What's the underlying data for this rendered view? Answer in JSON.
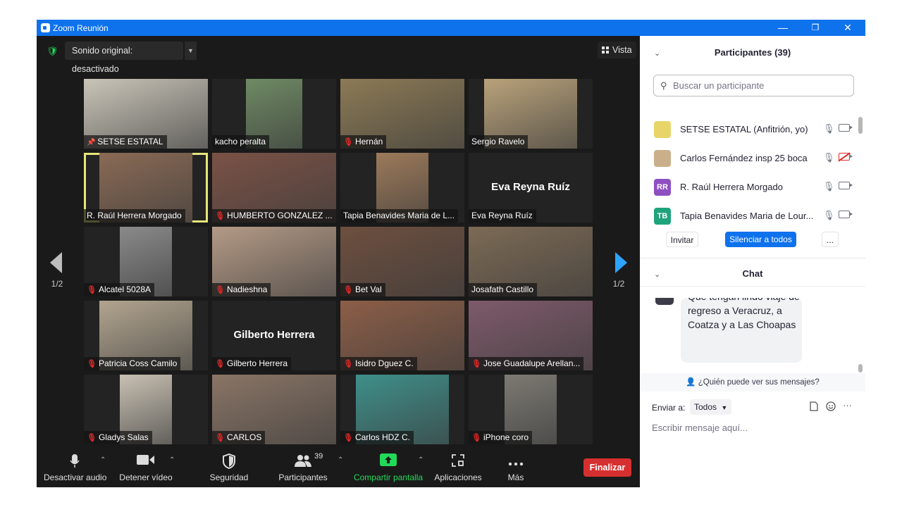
{
  "window": {
    "title": "Zoom Reunión",
    "minimize": "—",
    "restore": "❐",
    "close": "✕"
  },
  "top": {
    "sound_label": "Sonido original: desactivado",
    "view_label": "Vista"
  },
  "page_indicator": "1/2",
  "tiles": [
    {
      "name": "SETSE ESTATAL",
      "muted": false,
      "pinned": true,
      "big": "",
      "bg": "#c9c4b8",
      "vw": 176
    },
    {
      "name": "kacho peralta",
      "muted": false,
      "pinned": false,
      "big": "",
      "bg": "#6f8a64",
      "vw": 80
    },
    {
      "name": "Hernán",
      "muted": true,
      "pinned": false,
      "big": "",
      "bg": "#8c7a55",
      "vw": 176
    },
    {
      "name": "Sergio Ravelo",
      "muted": false,
      "pinned": false,
      "big": "",
      "bg": "#b9a27a",
      "vw": 132
    },
    {
      "name": "R. Raúl Herrera Morgado",
      "muted": false,
      "pinned": false,
      "big": "",
      "bg": "#8a6a55",
      "vw": 132,
      "active": true
    },
    {
      "name": "HUMBERTO GONZALEZ ...",
      "muted": true,
      "pinned": false,
      "big": "",
      "bg": "#7a5246",
      "vw": 176
    },
    {
      "name": "Tapia Benavides Maria de L...",
      "muted": false,
      "pinned": false,
      "big": "",
      "bg": "#9c7a5a",
      "vw": 74
    },
    {
      "name": "Eva Reyna Ruíz",
      "muted": false,
      "pinned": false,
      "big": "Eva Reyna Ruíz",
      "bg": "#232323",
      "vw": 0
    },
    {
      "name": "Alcatel 5028A",
      "muted": true,
      "pinned": false,
      "big": "",
      "bg": "#8a8a8a",
      "vw": 74
    },
    {
      "name": "Nadieshna",
      "muted": true,
      "pinned": false,
      "big": "",
      "bg": "#b49a86",
      "vw": 176
    },
    {
      "name": "Bet Val",
      "muted": true,
      "pinned": false,
      "big": "",
      "bg": "#6d4f3f",
      "vw": 176
    },
    {
      "name": "Josafath Castillo",
      "muted": false,
      "pinned": false,
      "big": "",
      "bg": "#7c6a55",
      "vw": 176
    },
    {
      "name": "Patricia Coss Camilo",
      "muted": true,
      "pinned": false,
      "big": "",
      "bg": "#b2a58f",
      "vw": 132
    },
    {
      "name": "Gilberto Herrera",
      "muted": true,
      "pinned": false,
      "big": "Gilberto Herrera",
      "bg": "#232323",
      "vw": 0
    },
    {
      "name": "Isidro Dguez C.",
      "muted": true,
      "pinned": false,
      "big": "",
      "bg": "#8c5e48",
      "vw": 176
    },
    {
      "name": "Jose Guadalupe Arellan...",
      "muted": true,
      "pinned": false,
      "big": "",
      "bg": "#7e5a6a",
      "vw": 176
    },
    {
      "name": "Gladys Salas",
      "muted": true,
      "pinned": false,
      "big": "",
      "bg": "#c8c0b2",
      "vw": 74
    },
    {
      "name": "CARLOS",
      "muted": true,
      "pinned": false,
      "big": "",
      "bg": "#8a7566",
      "vw": 176
    },
    {
      "name": "Carlos HDZ C.",
      "muted": true,
      "pinned": false,
      "big": "",
      "bg": "#3f8f8a",
      "vw": 132
    },
    {
      "name": "iPhone coro",
      "muted": true,
      "pinned": false,
      "big": "",
      "bg": "#7d7a73",
      "vw": 74
    }
  ],
  "toolbar": {
    "audio": "Desactivar audio",
    "video": "Detener vídeo",
    "security": "Seguridad",
    "participants": "Participantes",
    "participants_count": "39",
    "share": "Compartir pantalla",
    "apps": "Aplicaciones",
    "more": "Más",
    "end": "Finalizar"
  },
  "participants_panel": {
    "title": "Participantes (39)",
    "search_placeholder": "Buscar un participante",
    "rows": [
      {
        "initials": "",
        "avatar_color": "#e8d56a",
        "name": "SETSE ESTATAL (Anfitrión, yo)",
        "cam_off": false
      },
      {
        "initials": "",
        "avatar_color": "#c9b08a",
        "name": "Carlos Fernández insp 25 boca",
        "cam_off": true
      },
      {
        "initials": "RR",
        "avatar_color": "#8e4fc1",
        "name": "R. Raúl Herrera Morgado",
        "cam_off": false
      },
      {
        "initials": "TB",
        "avatar_color": "#1fa37a",
        "name": "Tapia Benavides Maria de Lour...",
        "cam_off": false
      }
    ],
    "invite": "Invitar",
    "mute_all": "Silenciar a todos",
    "more": "..."
  },
  "chat": {
    "title": "Chat",
    "message": "Que tengan lindo viaje de regreso a Veracruz, a Coatza y a Las Choapas",
    "who_sees": "¿Quién puede ver sus mensajes?",
    "send_to_label": "Enviar a:",
    "send_to_value": "Todos",
    "input_placeholder": "Escribir mensaje aquí..."
  }
}
